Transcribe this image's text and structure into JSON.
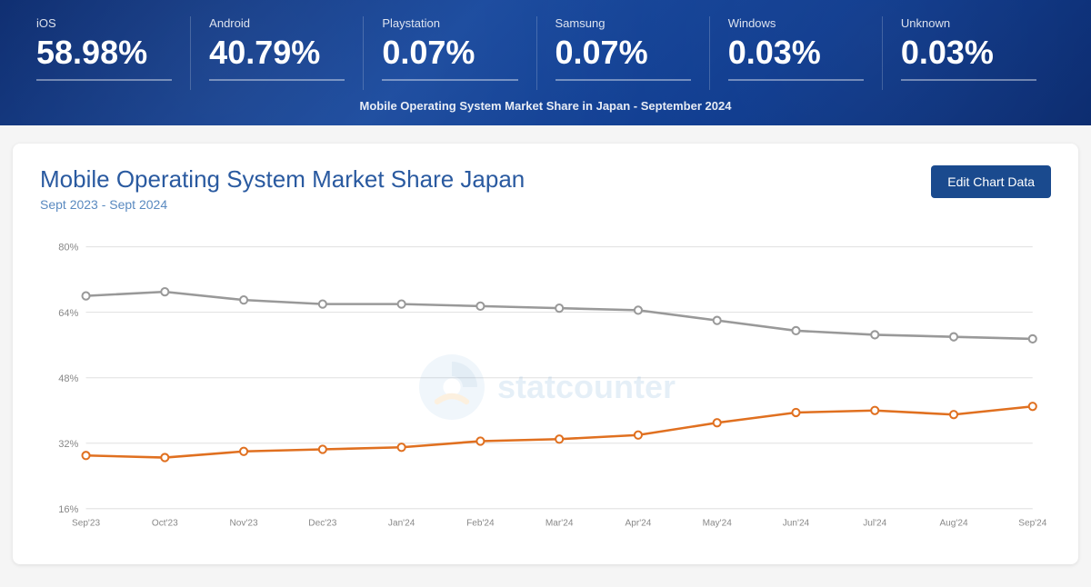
{
  "header": {
    "title": "Mobile Operating System Market Share in Japan - September 2024",
    "stats": [
      {
        "label": "iOS",
        "value": "58.98%"
      },
      {
        "label": "Android",
        "value": "40.79%"
      },
      {
        "label": "Playstation",
        "value": "0.07%"
      },
      {
        "label": "Samsung",
        "value": "0.07%"
      },
      {
        "label": "Windows",
        "value": "0.03%"
      },
      {
        "label": "Unknown",
        "value": "0.03%"
      }
    ]
  },
  "chart": {
    "title": "Mobile Operating System Market Share Japan",
    "subtitle": "Sept 2023 - Sept 2024",
    "edit_button": "Edit Chart Data",
    "yaxis_labels": [
      "16%",
      "32%",
      "48%",
      "64%",
      "80%"
    ],
    "colors": {
      "ios": "#999999",
      "android": "#e07020"
    },
    "ios_data": [
      68,
      69,
      67,
      66,
      66,
      65.5,
      65,
      64.5,
      62,
      59.5,
      58.5,
      58,
      57.5
    ],
    "android_data": [
      29,
      28.5,
      30,
      30.5,
      31,
      32.5,
      33,
      34,
      37,
      39.5,
      40,
      39,
      41
    ],
    "months": [
      "Sep'23",
      "Oct'23",
      "Nov'23",
      "Dec'23",
      "Jan'24",
      "Feb'24",
      "Mar'24",
      "Apr'24",
      "May'24",
      "Jun'24",
      "Jul'24",
      "Aug'24",
      "Sep'24"
    ]
  },
  "watermark": {
    "text": "statcounter"
  }
}
